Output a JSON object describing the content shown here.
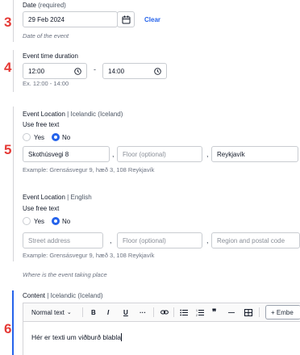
{
  "step_numbers": [
    "3",
    "4",
    "5",
    "6"
  ],
  "date": {
    "label": "Date",
    "required": "(required)",
    "value": "29 Feb 2024",
    "clear": "Clear",
    "help": "Date of the event"
  },
  "time": {
    "label": "Event time duration",
    "start": "12:00",
    "end": "14:00",
    "dash": "-",
    "help": "Ex. 12:00 - 14:00"
  },
  "location_is": {
    "label": "Event Location",
    "sep": "|",
    "lang": "Icelandic (Iceland)",
    "free_text": "Use free text",
    "yes": "Yes",
    "no": "No",
    "street": "Skothúsvegi 8",
    "floor_placeholder": "Floor (optional)",
    "region": "Reykjavík",
    "example": "Example: Grensásvegur 9, hæð 3, 108 Reykjavík"
  },
  "location_en": {
    "label": "Event Location",
    "sep": "|",
    "lang": "English",
    "free_text": "Use free text",
    "yes": "Yes",
    "no": "No",
    "street_placeholder": "Street address",
    "floor_placeholder": "Floor (optional)",
    "region_placeholder": "Region and postal code",
    "example": "Example: Grensásvegur 9, hæð 3, 108 Reykjavík"
  },
  "location_help": "Where is the event taking place",
  "content": {
    "label": "Content",
    "sep": "|",
    "lang": "Icelandic (Iceland)",
    "toolbar": {
      "format": "Normal text",
      "bold": "B",
      "italic": "I",
      "underline": "U",
      "more": "···",
      "quote": "❞",
      "divider": "—",
      "embed": "+ Embe"
    },
    "text": "Hér er texti um viðburð blabla"
  }
}
